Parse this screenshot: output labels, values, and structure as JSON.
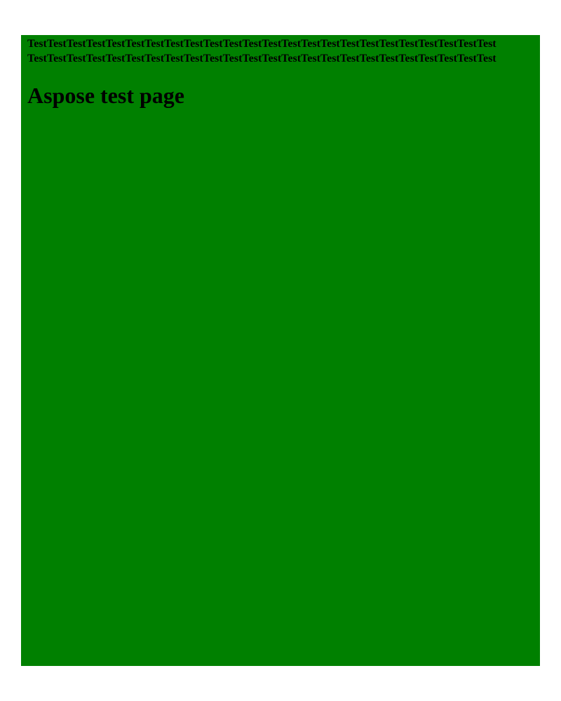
{
  "colors": {
    "page_background": "#ffffff",
    "panel_background": "#008000",
    "text": "#000000"
  },
  "content": {
    "line_1": "TestTestTestTestTestTestTestTestTestTestTestTestTestTestTestTestTestTestTestTestTestTestTestTest",
    "line_2": "TestTestTestTestTestTestTestTestTestTestTestTestTestTestTestTestTestTestTestTestTestTestTestTest",
    "heading": "Aspose test page"
  }
}
